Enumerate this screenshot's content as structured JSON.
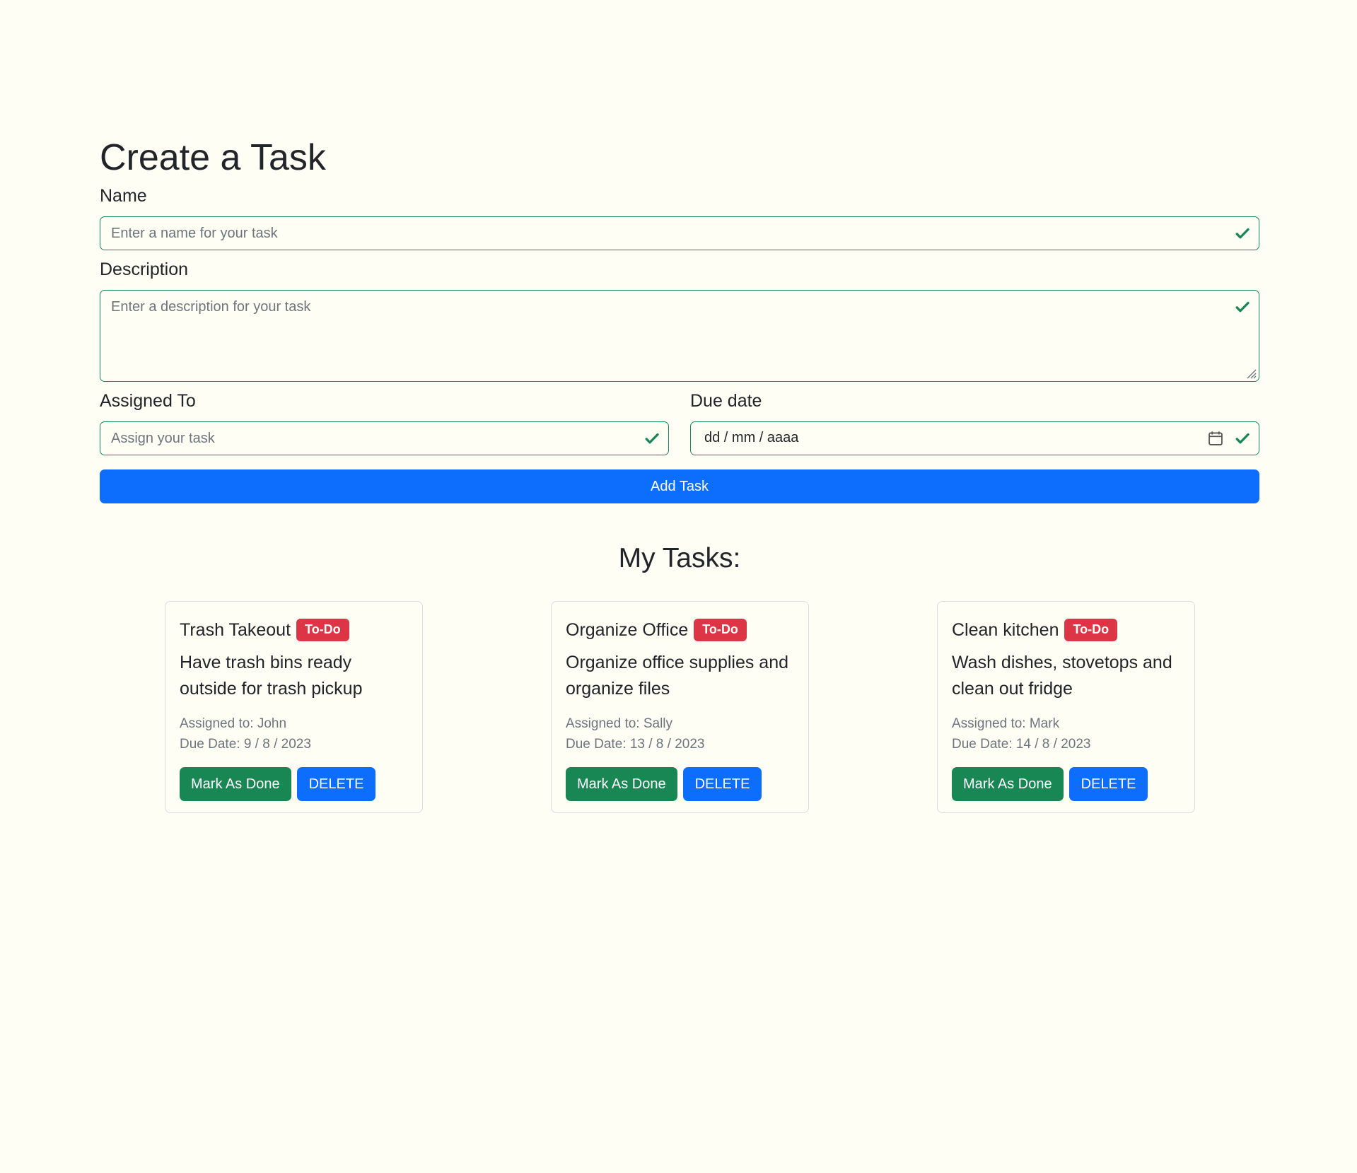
{
  "form": {
    "title": "Create a Task",
    "name_label": "Name",
    "name_placeholder": "Enter a name for your task",
    "description_label": "Description",
    "description_placeholder": "Enter a description for your task",
    "assigned_label": "Assigned To",
    "assigned_placeholder": "Assign your task",
    "due_label": "Due date",
    "due_placeholder": "dd / mm / aaaa",
    "submit_label": "Add Task"
  },
  "tasks_title": "My Tasks:",
  "tasks": [
    {
      "name": "Trash Takeout",
      "status": "To-Do",
      "description": "Have trash bins ready outside for trash pickup",
      "assigned": "Assigned to: John",
      "due": "Due Date: 9 / 8 / 2023",
      "done_label": "Mark As Done",
      "delete_label": "DELETE"
    },
    {
      "name": "Organize Office",
      "status": "To-Do",
      "description": "Organize office supplies and organize files",
      "assigned": "Assigned to: Sally",
      "due": "Due Date: 13 / 8 / 2023",
      "done_label": "Mark As Done",
      "delete_label": "DELETE"
    },
    {
      "name": "Clean kitchen",
      "status": "To-Do",
      "description": "Wash dishes, stovetops and clean out fridge",
      "assigned": "Assigned to: Mark",
      "due": "Due Date: 14 / 8 / 2023",
      "done_label": "Mark As Done",
      "delete_label": "DELETE"
    }
  ],
  "colors": {
    "background": "#fffef5",
    "valid_border": "#198754",
    "primary": "#0d6efd",
    "success": "#198754",
    "badge": "#dc3545"
  },
  "icons": {
    "valid": "check-icon",
    "calendar": "calendar-icon"
  }
}
